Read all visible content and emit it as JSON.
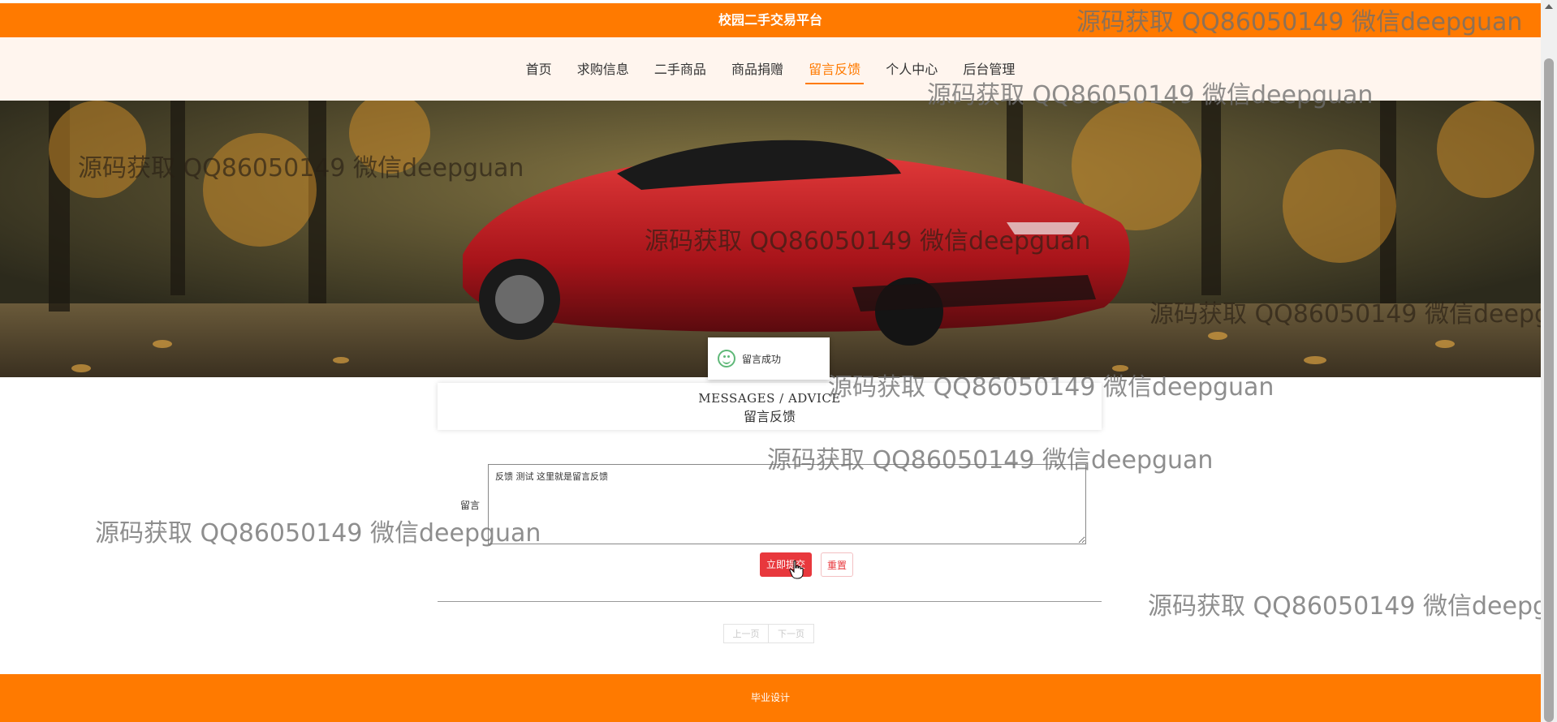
{
  "header": {
    "title": "校园二手交易平台"
  },
  "nav": {
    "items": [
      {
        "label": "首页",
        "active": false
      },
      {
        "label": "求购信息",
        "active": false
      },
      {
        "label": "二手商品",
        "active": false
      },
      {
        "label": "商品捐赠",
        "active": false
      },
      {
        "label": "留言反馈",
        "active": true
      },
      {
        "label": "个人中心",
        "active": false
      },
      {
        "label": "后台管理",
        "active": false
      }
    ]
  },
  "toast": {
    "message": "留言成功",
    "icon": "smile-icon"
  },
  "section": {
    "title_en": "MESSAGES / ADVICE",
    "title_cn": "留言反馈"
  },
  "form": {
    "label": "留言",
    "value": "反馈 测试 这里就是留言反馈",
    "submit_label": "立即提交",
    "reset_label": "重置"
  },
  "pager": {
    "prev_label": "上一页",
    "next_label": "下一页"
  },
  "footer": {
    "text": "毕业设计"
  },
  "watermark": {
    "text": "源码获取 QQ86050149 微信deepguan"
  },
  "colors": {
    "accent": "#ff7a00",
    "nav_bg": "#fff5ee",
    "button_red": "#e8383d",
    "success_green": "#5fb878"
  }
}
